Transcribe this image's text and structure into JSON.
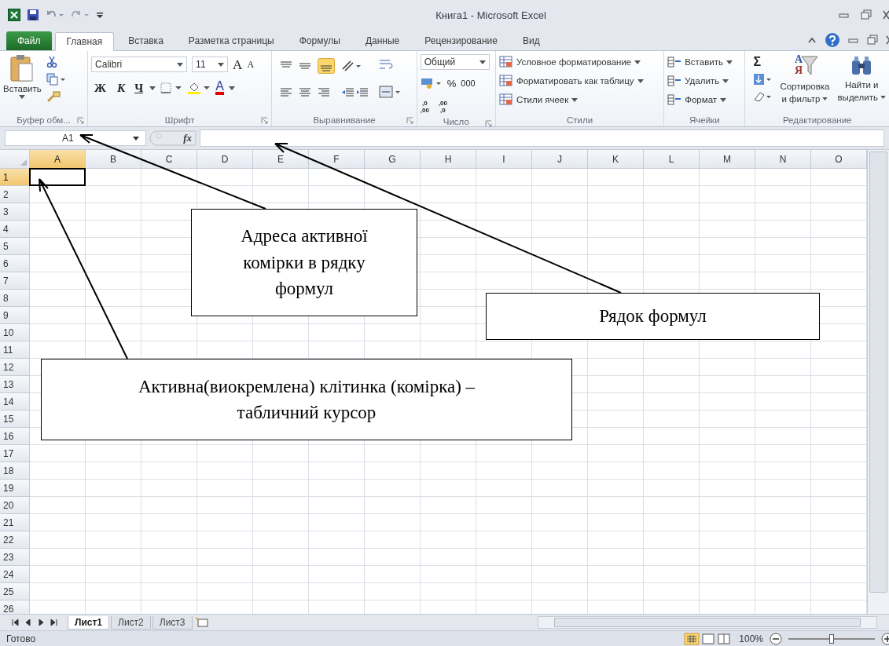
{
  "title_bar": {
    "title": "Книга1  -  Microsoft Excel"
  },
  "tabs": [
    {
      "label": "Файл",
      "kind": "file",
      "selected": false
    },
    {
      "label": "Главная",
      "kind": "tab",
      "selected": true
    },
    {
      "label": "Вставка",
      "kind": "tab",
      "selected": false
    },
    {
      "label": "Разметка страницы",
      "kind": "tab",
      "selected": false
    },
    {
      "label": "Формулы",
      "kind": "tab",
      "selected": false
    },
    {
      "label": "Данные",
      "kind": "tab",
      "selected": false
    },
    {
      "label": "Рецензирование",
      "kind": "tab",
      "selected": false
    },
    {
      "label": "Вид",
      "kind": "tab",
      "selected": false
    }
  ],
  "ribbon": {
    "clipboard": {
      "paste": "Вставить",
      "label": "Буфер обм..."
    },
    "font": {
      "name": "Calibri",
      "size": "11",
      "grow": "A",
      "shrink": "A",
      "bold": "Ж",
      "italic": "К",
      "underline": "Ч",
      "font_color_letter": "A",
      "label": "Шрифт"
    },
    "alignment": {
      "label": "Выравнивание"
    },
    "number": {
      "format": "Общий",
      "percent": "%",
      "thousands": "000",
      "increase_decimal": [
        ",0",
        ",00"
      ],
      "decrease_decimal": [
        ",00",
        ",0"
      ],
      "label": "Число"
    },
    "styles": {
      "items": [
        "Условное форматирование",
        "Форматировать как таблицу",
        "Стили ячеек"
      ],
      "label": "Стили"
    },
    "cells": {
      "items": [
        "Вставить",
        "Удалить",
        "Формат"
      ],
      "label": "Ячейки"
    },
    "editing": {
      "sum": "Σ",
      "sort_letters": [
        "А",
        "Я"
      ],
      "sort": [
        "Сортировка",
        "и фильтр"
      ],
      "find": [
        "Найти и",
        "выделить"
      ],
      "label": "Редактирование"
    }
  },
  "formula_bar": {
    "name_box": "A1",
    "fx": "fx"
  },
  "sheet": {
    "columns": [
      {
        "label": "A",
        "selected": true
      },
      {
        "label": "B",
        "selected": false
      },
      {
        "label": "C",
        "selected": false
      },
      {
        "label": "D",
        "selected": false
      },
      {
        "label": "E",
        "selected": false
      },
      {
        "label": "F",
        "selected": false
      },
      {
        "label": "G",
        "selected": false
      },
      {
        "label": "H",
        "selected": false
      },
      {
        "label": "I",
        "selected": false
      },
      {
        "label": "J",
        "selected": false
      },
      {
        "label": "K",
        "selected": false
      },
      {
        "label": "L",
        "selected": false
      },
      {
        "label": "M",
        "selected": false
      },
      {
        "label": "N",
        "selected": false
      },
      {
        "label": "O",
        "selected": false
      }
    ],
    "rows": [
      {
        "label": "1",
        "selected": true
      },
      {
        "label": "2",
        "selected": false
      },
      {
        "label": "3",
        "selected": false
      },
      {
        "label": "4",
        "selected": false
      },
      {
        "label": "5",
        "selected": false
      },
      {
        "label": "6",
        "selected": false
      },
      {
        "label": "7",
        "selected": false
      },
      {
        "label": "8",
        "selected": false
      },
      {
        "label": "9",
        "selected": false
      },
      {
        "label": "10",
        "selected": false
      },
      {
        "label": "11",
        "selected": false
      },
      {
        "label": "12",
        "selected": false
      },
      {
        "label": "13",
        "selected": false
      },
      {
        "label": "14",
        "selected": false
      },
      {
        "label": "15",
        "selected": false
      },
      {
        "label": "16",
        "selected": false
      },
      {
        "label": "17",
        "selected": false
      },
      {
        "label": "18",
        "selected": false
      },
      {
        "label": "19",
        "selected": false
      },
      {
        "label": "20",
        "selected": false
      },
      {
        "label": "21",
        "selected": false
      },
      {
        "label": "22",
        "selected": false
      },
      {
        "label": "23",
        "selected": false
      },
      {
        "label": "24",
        "selected": false
      },
      {
        "label": "25",
        "selected": false
      },
      {
        "label": "26",
        "selected": false
      }
    ]
  },
  "sheet_tabs": [
    {
      "label": "Лист1",
      "selected": true
    },
    {
      "label": "Лист2",
      "selected": false
    },
    {
      "label": "Лист3",
      "selected": false
    }
  ],
  "status_bar": {
    "status": "Готово",
    "zoom": "100%",
    "zoom_slider": {
      "level": 0.5
    }
  },
  "callouts": [
    {
      "kind": "address",
      "text": "Адреса активної\nкомірки в рядку\nформул"
    },
    {
      "kind": "formula",
      "text": "Рядок формул"
    },
    {
      "kind": "cell",
      "text": "Активна(виокремлена)  клітинка (комірка) –\nтабличний курсор"
    }
  ]
}
